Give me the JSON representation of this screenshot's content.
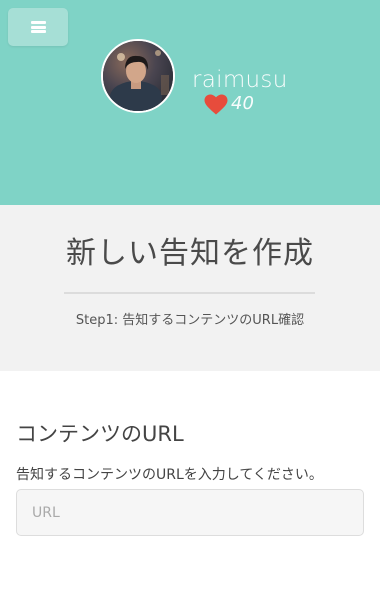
{
  "header": {
    "background_color": "#7fd3c6",
    "menu_icon": "hamburger-icon",
    "username": "raimusu",
    "likes": {
      "icon": "heart-icon",
      "icon_color": "#e74c3c",
      "count": "40"
    }
  },
  "title_section": {
    "title": "新しい告知を作成",
    "step": "Step1: 告知するコンテンツのURL確認"
  },
  "form": {
    "heading": "コンテンツのURL",
    "help_text": "告知するコンテンツのURLを入力してください。",
    "url_input": {
      "value": "",
      "placeholder": "URL"
    }
  }
}
